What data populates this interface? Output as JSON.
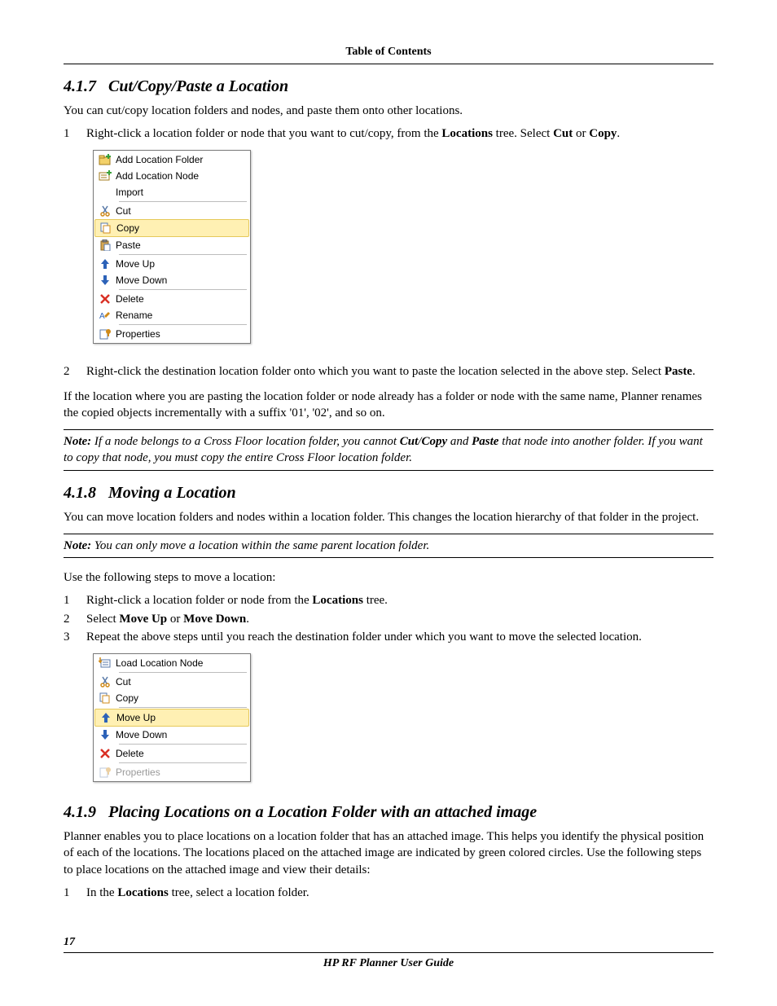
{
  "header": {
    "toc": "Table of Contents"
  },
  "section_417": {
    "number": "4.1.7",
    "title": "Cut/Copy/Paste a Location",
    "intro": "You can cut/copy location folders and nodes, and paste them onto other locations.",
    "step1_a": "Right-click a location folder or node that you want to cut/copy, from the ",
    "step1_b": "Locations",
    "step1_c": " tree. Select ",
    "step1_d": "Cut",
    "step1_e": " or ",
    "step1_f": "Copy",
    "step1_g": ".",
    "step2_a": "Right-click the destination location folder onto which you want to paste the location selected in the above step. Select ",
    "step2_b": "Paste",
    "step2_c": ".",
    "renamePara": "If the location where you are pasting the location folder or node already has a folder or node with the same name, Planner renames the copied objects incrementally with a suffix '01', '02', and so on.",
    "note_a": "Note:",
    "note_b": " If a node belongs to a Cross Floor location folder, you cannot ",
    "note_c": "Cut",
    "note_d": "/",
    "note_e": "Copy",
    "note_f": " and ",
    "note_g": "Paste",
    "note_h": " that node into another folder. If you want to copy that node, you must copy the entire Cross Floor location folder."
  },
  "menu1": {
    "add_folder": "Add Location Folder",
    "add_node": "Add Location Node",
    "import": "Import",
    "cut": "Cut",
    "copy": "Copy",
    "paste": "Paste",
    "move_up": "Move Up",
    "move_down": "Move Down",
    "delete": "Delete",
    "rename": "Rename",
    "properties": "Properties"
  },
  "section_418": {
    "number": "4.1.8",
    "title": "Moving a Location",
    "intro": "You can move location folders and nodes within a location folder. This changes the location hierarchy of that folder in the project.",
    "note_a": "Note:",
    "note_b": " You can only move a location within the same parent location folder.",
    "useSteps": "Use the following steps to move a location:",
    "step1_a": "Right-click a location folder or node from the ",
    "step1_b": "Locations",
    "step1_c": " tree.",
    "step2_a": "Select ",
    "step2_b": "Move Up",
    "step2_c": " or ",
    "step2_d": "Move Down",
    "step2_e": ".",
    "step3": "Repeat the above steps until you reach the destination folder under which you want to move the selected location."
  },
  "menu2": {
    "load_node": "Load Location Node",
    "cut": "Cut",
    "copy": "Copy",
    "move_up": "Move Up",
    "move_down": "Move Down",
    "delete": "Delete",
    "properties": "Properties"
  },
  "section_419": {
    "number": "4.1.9",
    "title": "Placing Locations on a Location Folder with an attached image",
    "intro": "Planner enables you to place locations on a location folder that has an attached image. This helps you identify the physical position of each of the locations. The locations placed on the attached image are indicated by green colored circles. Use the following steps to place locations on the attached image and view their details:",
    "step1_a": "In the ",
    "step1_b": "Locations",
    "step1_c": " tree, select a location folder."
  },
  "footer": {
    "page": "17",
    "doc": "HP RF Planner User Guide"
  },
  "nums": {
    "n1": "1",
    "n2": "2",
    "n3": "3"
  }
}
